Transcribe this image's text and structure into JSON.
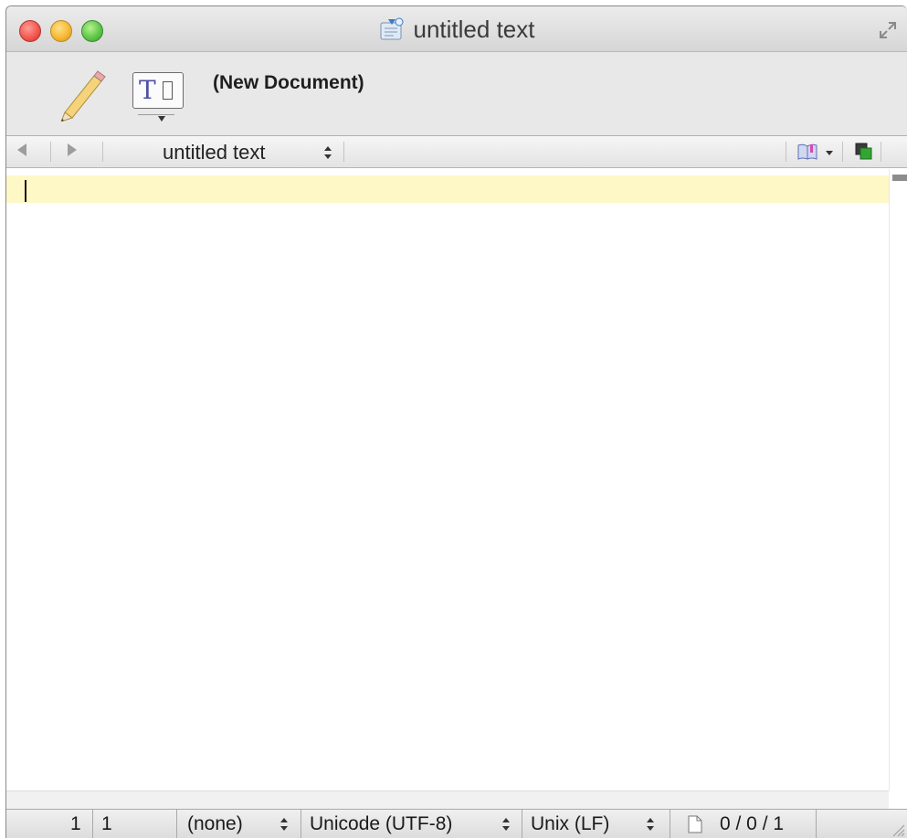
{
  "window": {
    "title": "untitled text"
  },
  "toolbar": {
    "document_label": "(New Document)"
  },
  "navbar": {
    "document_popup": "untitled text"
  },
  "statusbar": {
    "line": "1",
    "column": "1",
    "language": "(none)",
    "encoding": "Unicode (UTF-8)",
    "line_endings": "Unix (LF)",
    "doc_stats": "0 / 0 / 1"
  },
  "colors": {
    "current_line_highlight": "#fdf8c6",
    "close_button": "#f25a50",
    "minimize_button": "#f6b936",
    "zoom_button": "#5fc84a"
  },
  "icons": [
    "close-button",
    "minimize-button",
    "zoom-button",
    "document-proxy-icon",
    "fullscreen-icon",
    "pencil-icon",
    "text-style-icon",
    "back-arrow-icon",
    "forward-arrow-icon",
    "popup-stepper-icon",
    "notes-icon",
    "counterpart-icon",
    "document-stats-icon",
    "resize-grip-icon"
  ]
}
